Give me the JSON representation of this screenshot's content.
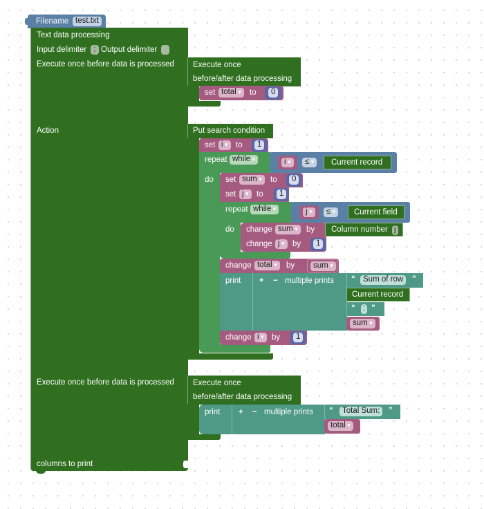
{
  "file_block": {
    "label": "Filename",
    "value": "test.txt"
  },
  "main_block": {
    "title": "Text data processing",
    "input_delimiter_label": "Input delimiter",
    "input_delimiter_value": ";",
    "output_delimiter_label": "Output delimiter",
    "output_delimiter_value": "",
    "before_label": "Execute once before data is processed",
    "action_label": "Action",
    "after_label": "Execute once before data is processed",
    "columns_label": "columns to print"
  },
  "before_block": {
    "title1": "Execute once",
    "title2": "before/after data processing",
    "set": {
      "kw": "set",
      "var": "total",
      "to": "to",
      "value": "0"
    }
  },
  "action_block": {
    "title": "Put search condition",
    "set_i": {
      "kw": "set",
      "var": "i",
      "to": "to",
      "value": "1"
    },
    "repeat_outer": {
      "kw": "repeat",
      "mode": "while",
      "lhs": "i",
      "op": "≤",
      "rhs": "Current record",
      "do": "do"
    },
    "set_sum": {
      "kw": "set",
      "var": "sum",
      "to": "to",
      "value": "0"
    },
    "set_j": {
      "kw": "set",
      "var": "j",
      "to": "to",
      "value": "1"
    },
    "repeat_inner": {
      "kw": "repeat",
      "mode": "while",
      "lhs": "j",
      "op": "≤",
      "rhs": "Current field",
      "do": "do"
    },
    "change_sum": {
      "kw": "change",
      "var": "sum",
      "by": "by",
      "value_label": "Column number",
      "value_arg": "j"
    },
    "change_j": {
      "kw": "change",
      "var": "j",
      "by": "by",
      "value": "1"
    },
    "change_total": {
      "kw": "change",
      "var": "total",
      "by": "by",
      "value_var": "sum"
    },
    "print": {
      "kw": "print",
      "plus": "+",
      "minus": "−",
      "label": "multiple prints",
      "items": [
        {
          "type": "text",
          "value": "Sum of row"
        },
        {
          "type": "field",
          "value": "Current record"
        },
        {
          "type": "text",
          "value": ":"
        },
        {
          "type": "var",
          "value": "sum"
        }
      ]
    },
    "change_i": {
      "kw": "change",
      "var": "i",
      "by": "by",
      "value": "1"
    }
  },
  "after_block": {
    "title1": "Execute once",
    "title2": "before/after data processing",
    "print": {
      "kw": "print",
      "plus": "+",
      "minus": "−",
      "label": "multiple prints",
      "items": [
        {
          "type": "text",
          "value": "Total Sum:"
        },
        {
          "type": "var",
          "value": "total"
        }
      ]
    }
  },
  "quotes": {
    "open": "“",
    "close": "”"
  }
}
